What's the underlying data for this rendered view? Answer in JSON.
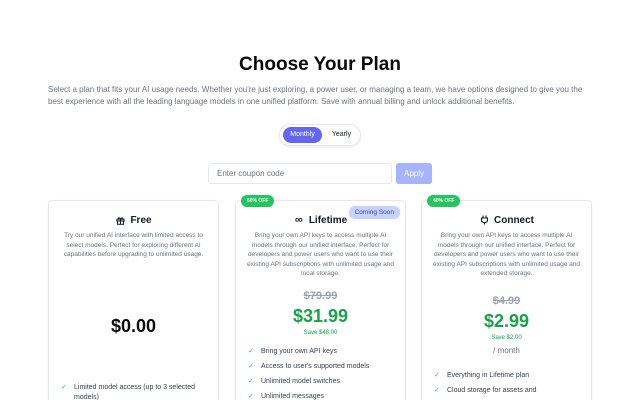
{
  "header": {
    "title": "Choose Your Plan",
    "description": "Select a plan that fits your AI usage needs. Whether you're just exploring, a power user, or managing a team, we have options designed to give you the best experience with all the leading language models in one unified platform. Save with annual billing and unlock additional benefits."
  },
  "billing_toggle": {
    "monthly_label": "Monthly",
    "yearly_label": "Yearly",
    "selected": "Monthly"
  },
  "coupon": {
    "placeholder": "Enter coupon code",
    "value": "",
    "apply_label": "Apply"
  },
  "plans": [
    {
      "name": "Free",
      "icon": "gift-icon",
      "description": "Try our unified AI interface with limited access to select models. Perfect for exploring different AI capabilities before upgrading to unlimited usage.",
      "price": "$0.00",
      "features": [
        "Limited model access (up to 3 selected models)"
      ]
    },
    {
      "name": "Lifetime",
      "icon": "infinity-icon",
      "badge": "60% OFF",
      "status_badge": "Coming Soon",
      "description": "Bring your own API keys to access multiple AI models through our unified interface. Perfect for developers and power users who want to use their existing API subscriptions with unlimited usage and local storage.",
      "original_price": "$79.99",
      "price": "$31.99",
      "savings": "Save $48.00",
      "features": [
        "Bring your own API keys",
        "Access to user's supported models",
        "Unlimited model switches",
        "Unlimited messages"
      ]
    },
    {
      "name": "Connect",
      "icon": "plug-icon",
      "badge": "40% OFF",
      "description": "Bring your own API keys to access multiple AI models through our unified interface. Perfect for developers and power users who want to use their existing API subscriptions with unlimited usage and extended storage.",
      "original_price": "$4.99",
      "price": "$2.99",
      "savings": "Save $2.00",
      "period": "/ month",
      "features": [
        "Everything in Lifetime plan",
        "Cloud storage for assets and"
      ]
    }
  ],
  "colors": {
    "accent": "#6366f1",
    "price_green": "#16a34a",
    "badge_green": "#22c55e",
    "apply_button": "#a5b4fc",
    "coming_soon_bg": "#c7d2fe"
  }
}
